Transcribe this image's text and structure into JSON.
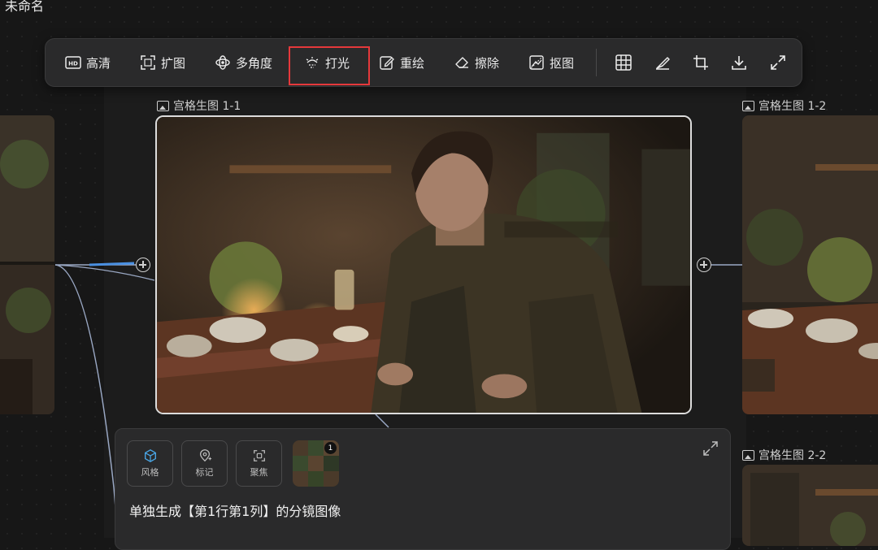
{
  "document": {
    "title": "未命名"
  },
  "toolbar": {
    "buttons": [
      {
        "label": "高清",
        "icon": "hd-icon"
      },
      {
        "label": "扩图",
        "icon": "expand-frame-icon"
      },
      {
        "label": "多角度",
        "icon": "multi-angle-icon"
      },
      {
        "label": "打光",
        "icon": "lighting-icon"
      },
      {
        "label": "重绘",
        "icon": "edit-icon"
      },
      {
        "label": "擦除",
        "icon": "eraser-icon"
      },
      {
        "label": "抠图",
        "icon": "cutout-icon"
      }
    ],
    "hd_badge": "HD",
    "icon_tools": [
      "grid-icon",
      "brush-icon",
      "crop-icon",
      "download-icon",
      "fullscreen-icon"
    ],
    "highlight_color": "#e5383b"
  },
  "canvas": {
    "images": [
      {
        "label": "宫格生图 1-1"
      },
      {
        "label": "宫格生图 1-2"
      },
      {
        "label": "宫格生图 2-2"
      }
    ],
    "connector_color": "#8aa0c8",
    "accent_color": "#4a90e2"
  },
  "prompt_panel": {
    "chips": [
      {
        "label": "风格",
        "icon": "cube-icon"
      },
      {
        "label": "标记",
        "icon": "pin-icon"
      },
      {
        "label": "聚焦",
        "icon": "focus-icon"
      }
    ],
    "reference_count": "1",
    "prompt": "单独生成【第1行第1列】的分镜图像"
  }
}
